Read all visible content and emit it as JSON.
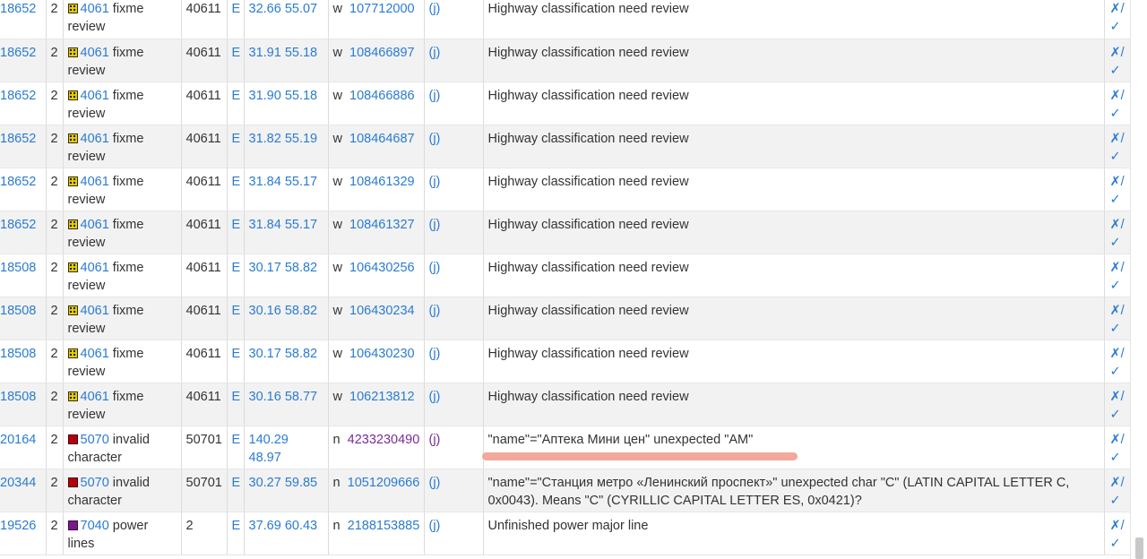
{
  "colors": {
    "link": "#2a7bd3",
    "visited": "#7b2a9b",
    "fixme": "#e8d000",
    "invalid": "#b00010",
    "power": "#7a1a8a",
    "underline": "#f0a090"
  },
  "actions": {
    "fix": "✗",
    "sep": "/",
    "ok": "✓"
  },
  "rows": [
    {
      "id": "18652",
      "level": "2",
      "icon": "fixme-icon",
      "item": "4061",
      "cls": "fixme review",
      "class_id": "40611",
      "e": "E",
      "coord": "32.66 55.07",
      "t": "w",
      "osm": "107712000",
      "j": "(j)",
      "msg": "Highway classification need review"
    },
    {
      "id": "18652",
      "level": "2",
      "icon": "fixme-icon",
      "item": "4061",
      "cls": "fixme review",
      "class_id": "40611",
      "e": "E",
      "coord": "31.91 55.18",
      "t": "w",
      "osm": "108466897",
      "j": "(j)",
      "msg": "Highway classification need review"
    },
    {
      "id": "18652",
      "level": "2",
      "icon": "fixme-icon",
      "item": "4061",
      "cls": "fixme review",
      "class_id": "40611",
      "e": "E",
      "coord": "31.90 55.18",
      "t": "w",
      "osm": "108466886",
      "j": "(j)",
      "msg": "Highway classification need review"
    },
    {
      "id": "18652",
      "level": "2",
      "icon": "fixme-icon",
      "item": "4061",
      "cls": "fixme review",
      "class_id": "40611",
      "e": "E",
      "coord": "31.82 55.19",
      "t": "w",
      "osm": "108464687",
      "j": "(j)",
      "msg": "Highway classification need review"
    },
    {
      "id": "18652",
      "level": "2",
      "icon": "fixme-icon",
      "item": "4061",
      "cls": "fixme review",
      "class_id": "40611",
      "e": "E",
      "coord": "31.84 55.17",
      "t": "w",
      "osm": "108461329",
      "j": "(j)",
      "msg": "Highway classification need review"
    },
    {
      "id": "18652",
      "level": "2",
      "icon": "fixme-icon",
      "item": "4061",
      "cls": "fixme review",
      "class_id": "40611",
      "e": "E",
      "coord": "31.84 55.17",
      "t": "w",
      "osm": "108461327",
      "j": "(j)",
      "msg": "Highway classification need review"
    },
    {
      "id": "18508",
      "level": "2",
      "icon": "fixme-icon",
      "item": "4061",
      "cls": "fixme review",
      "class_id": "40611",
      "e": "E",
      "coord": "30.17 58.82",
      "t": "w",
      "osm": "106430256",
      "j": "(j)",
      "msg": "Highway classification need review"
    },
    {
      "id": "18508",
      "level": "2",
      "icon": "fixme-icon",
      "item": "4061",
      "cls": "fixme review",
      "class_id": "40611",
      "e": "E",
      "coord": "30.16 58.82",
      "t": "w",
      "osm": "106430234",
      "j": "(j)",
      "msg": "Highway classification need review"
    },
    {
      "id": "18508",
      "level": "2",
      "icon": "fixme-icon",
      "item": "4061",
      "cls": "fixme review",
      "class_id": "40611",
      "e": "E",
      "coord": "30.17 58.82",
      "t": "w",
      "osm": "106430230",
      "j": "(j)",
      "msg": "Highway classification need review"
    },
    {
      "id": "18508",
      "level": "2",
      "icon": "fixme-icon",
      "item": "4061",
      "cls": "fixme review",
      "class_id": "40611",
      "e": "E",
      "coord": "30.16 58.77",
      "t": "w",
      "osm": "106213812",
      "j": "(j)",
      "msg": "Highway classification need review"
    },
    {
      "id": "20164",
      "level": "2",
      "icon": "invalid-icon",
      "item": "5070",
      "cls": "invalid character",
      "class_id": "50701",
      "e": "E",
      "coord": "140.29 48.97",
      "t": "n",
      "osm": "4233230490",
      "j": "(j)",
      "visited": true,
      "msg": "\"name\"=\"Аптека Мини цен\" unexpected \"AM\""
    },
    {
      "id": "20344",
      "level": "2",
      "icon": "invalid-icon",
      "item": "5070",
      "cls": "invalid character",
      "class_id": "50701",
      "e": "E",
      "coord": "30.27 59.85",
      "t": "n",
      "osm": "1051209666",
      "j": "(j)",
      "msg": "\"name\"=\"Станция метро «Ленинский проспект»\" unexpected char \"С\" (LATIN CAPITAL LETTER C, 0x0043). Means \"С\" (CYRILLIC CAPITAL LETTER ES, 0x0421)?"
    },
    {
      "id": "19526",
      "level": "2",
      "icon": "power-icon",
      "item": "7040",
      "cls": "power lines",
      "class_id": "2",
      "e": "E",
      "coord": "37.69 60.43",
      "t": "n",
      "osm": "2188153885",
      "j": "(j)",
      "msg": "Unfinished power major line"
    }
  ]
}
